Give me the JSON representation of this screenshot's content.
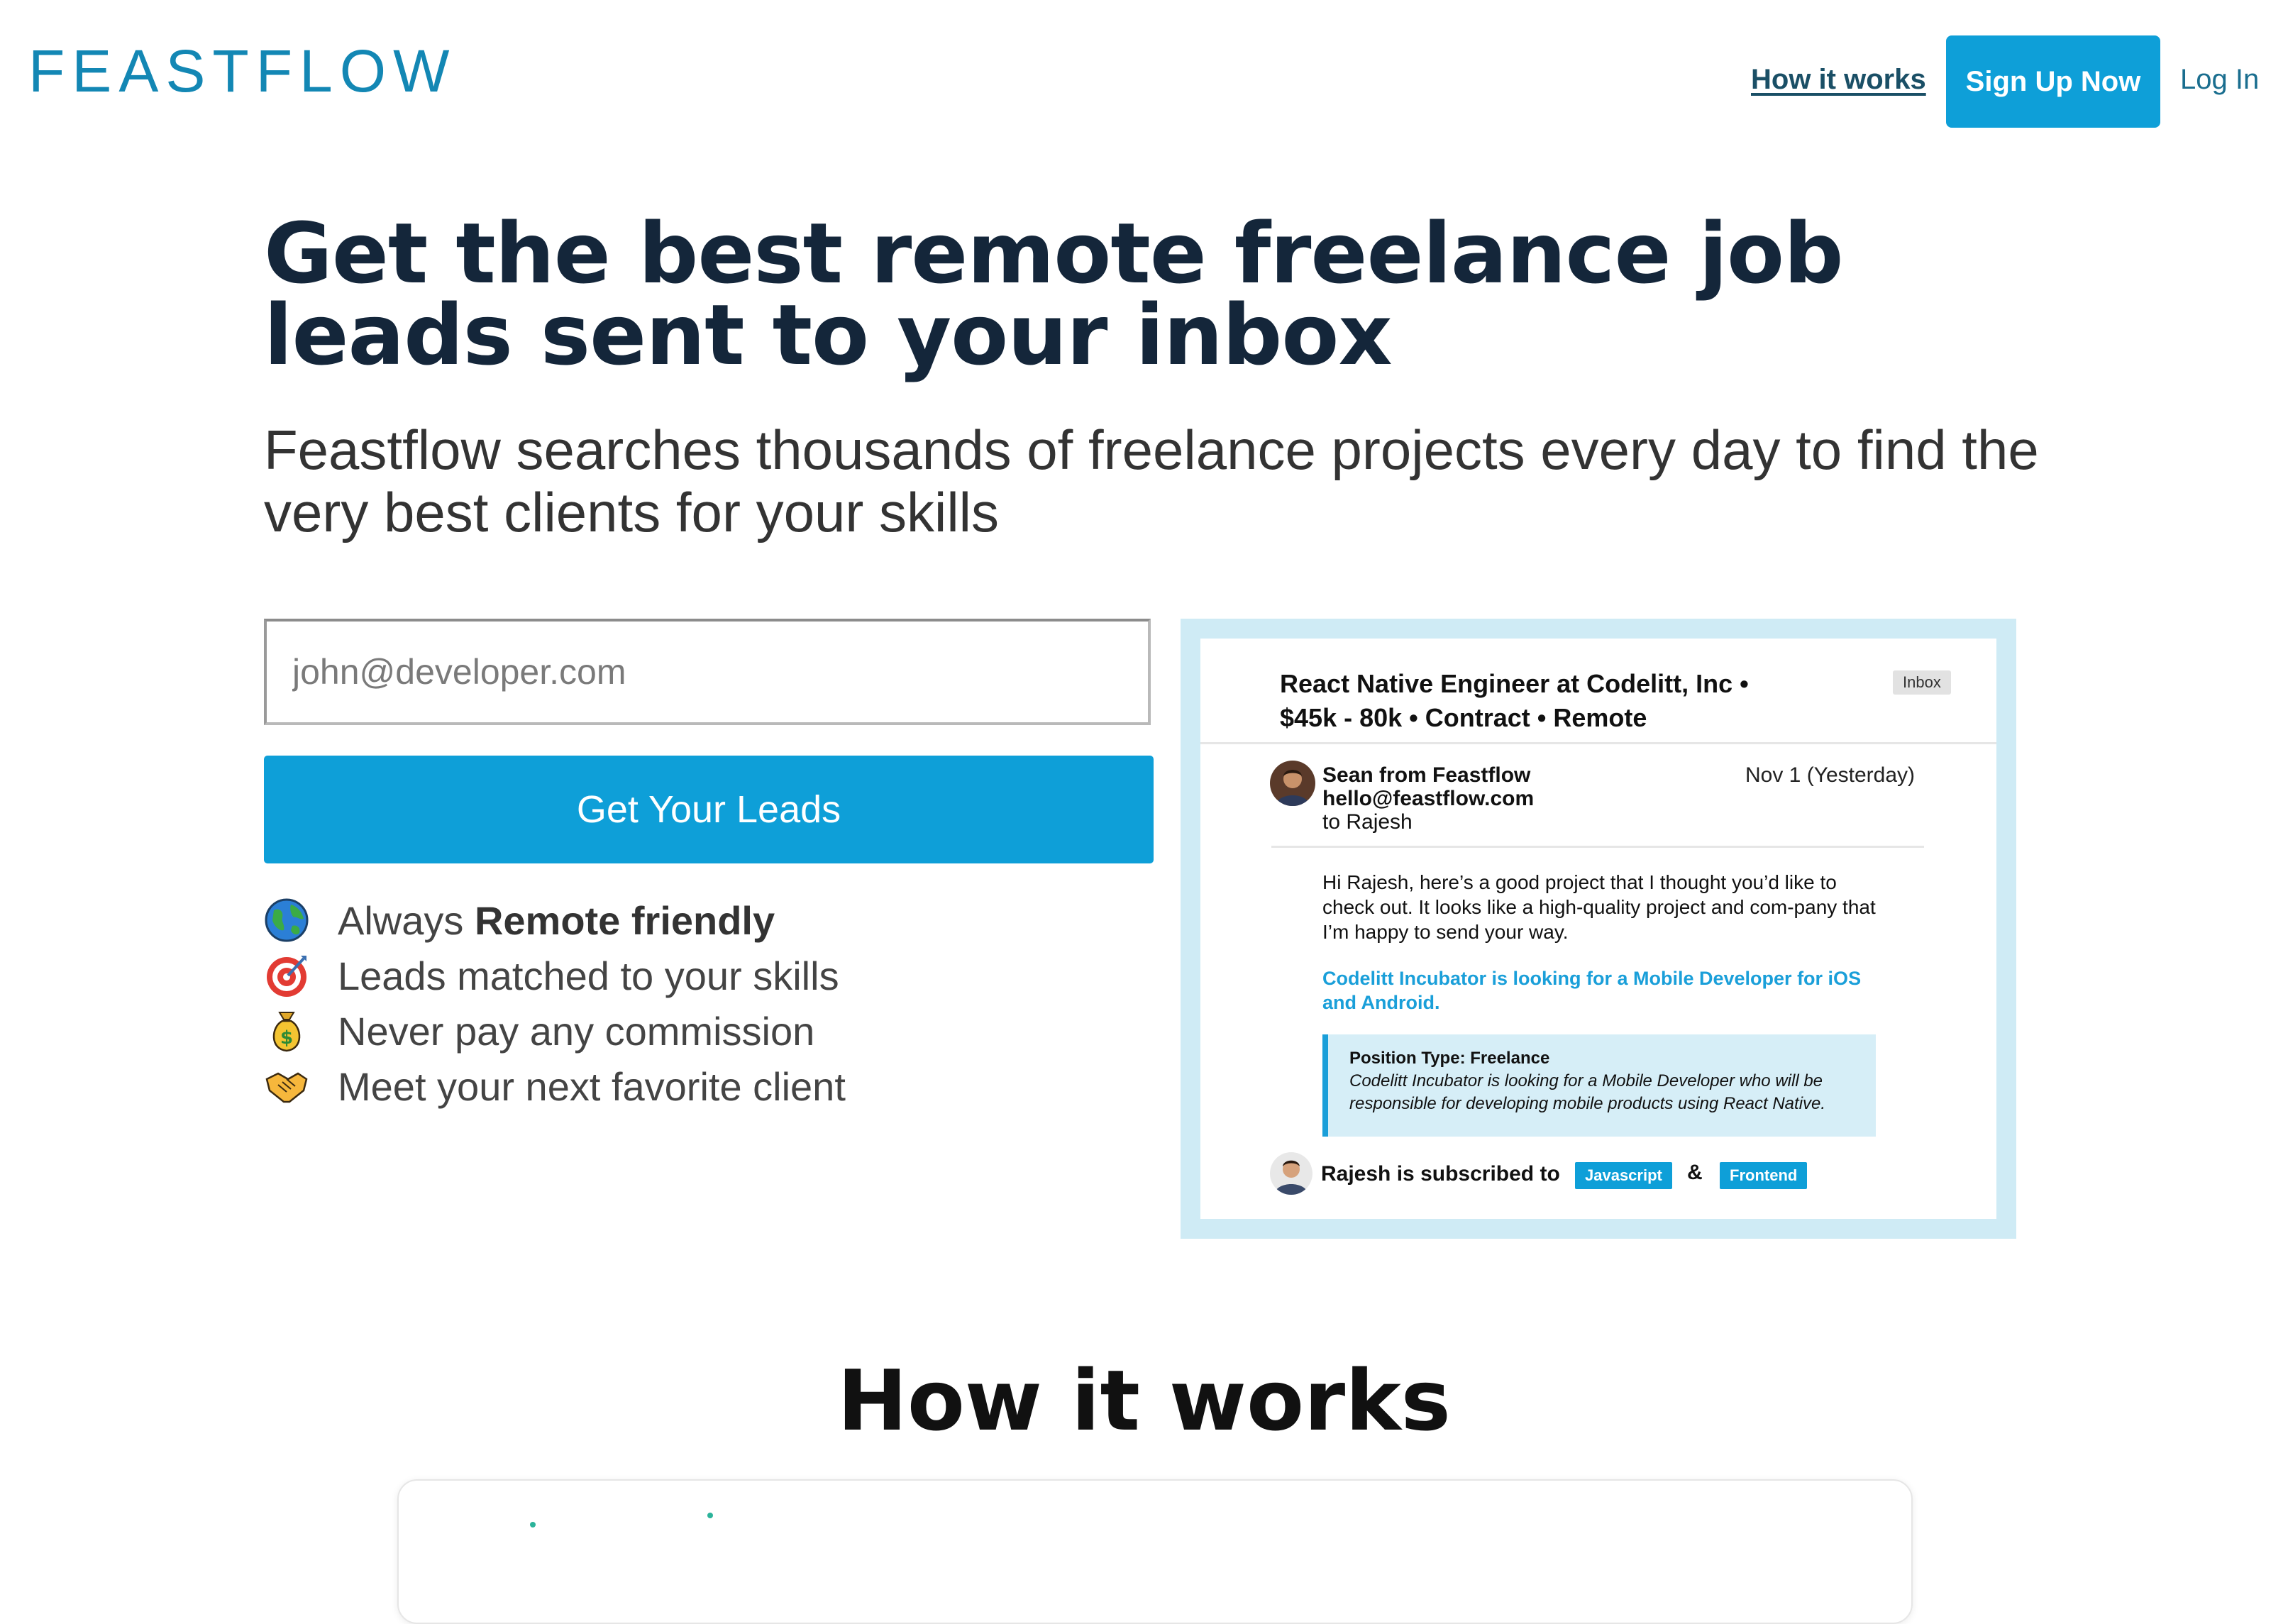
{
  "nav": {
    "logo": "FEASTFLOW",
    "how_it_works": "How it works",
    "signup": "Sign Up Now",
    "login": "Log In"
  },
  "hero": {
    "title": "Get the best remote freelance job leads sent to your inbox",
    "subtitle": "Feastflow searches thousands of freelance projects every day to find the very best clients for your skills"
  },
  "form": {
    "email_placeholder": "john@developer.com",
    "submit_label": "Get Your Leads"
  },
  "features": [
    {
      "icon": "globe-icon",
      "prefix": "Always ",
      "bold": "Remote friendly"
    },
    {
      "icon": "target-icon",
      "text": "Leads matched to your skills"
    },
    {
      "icon": "money-bag-icon",
      "text": "Never pay any commission"
    },
    {
      "icon": "handshake-icon",
      "text": "Meet your next favorite client"
    }
  ],
  "email_preview": {
    "subject_line1": "React Native Engineer at Codelitt, Inc •",
    "subject_line2": "$45k - 80k • Contract • Remote",
    "inbox_badge": "Inbox",
    "sender_name": "Sean from Feastflow",
    "sender_email": "hello@feastflow.com",
    "recipient": "to Rajesh",
    "date": "Nov 1 (Yesterday)",
    "body": "Hi Rajesh, here’s a good project that I thought you’d like to check out. It looks like a high-quality project and com-pany that I’m happy to send your way.",
    "project_link": "Codelitt Incubator is looking for a Mobile Developer for iOS and Android.",
    "position_label": "Position Type: Freelance",
    "position_desc": "Codelitt Incubator is looking for a Mobile Developer who will be responsible for developing mobile products using React Native.",
    "subscribed_text": "Rajesh is subscribed to",
    "tags": [
      "Javascript",
      "Frontend"
    ],
    "amp": "&"
  },
  "how_it_works": {
    "title": "How it works"
  },
  "colors": {
    "brand": "#1387b4",
    "button": "#0e9fd8",
    "heading": "#14263a",
    "preview_bg": "#cfebf5"
  }
}
